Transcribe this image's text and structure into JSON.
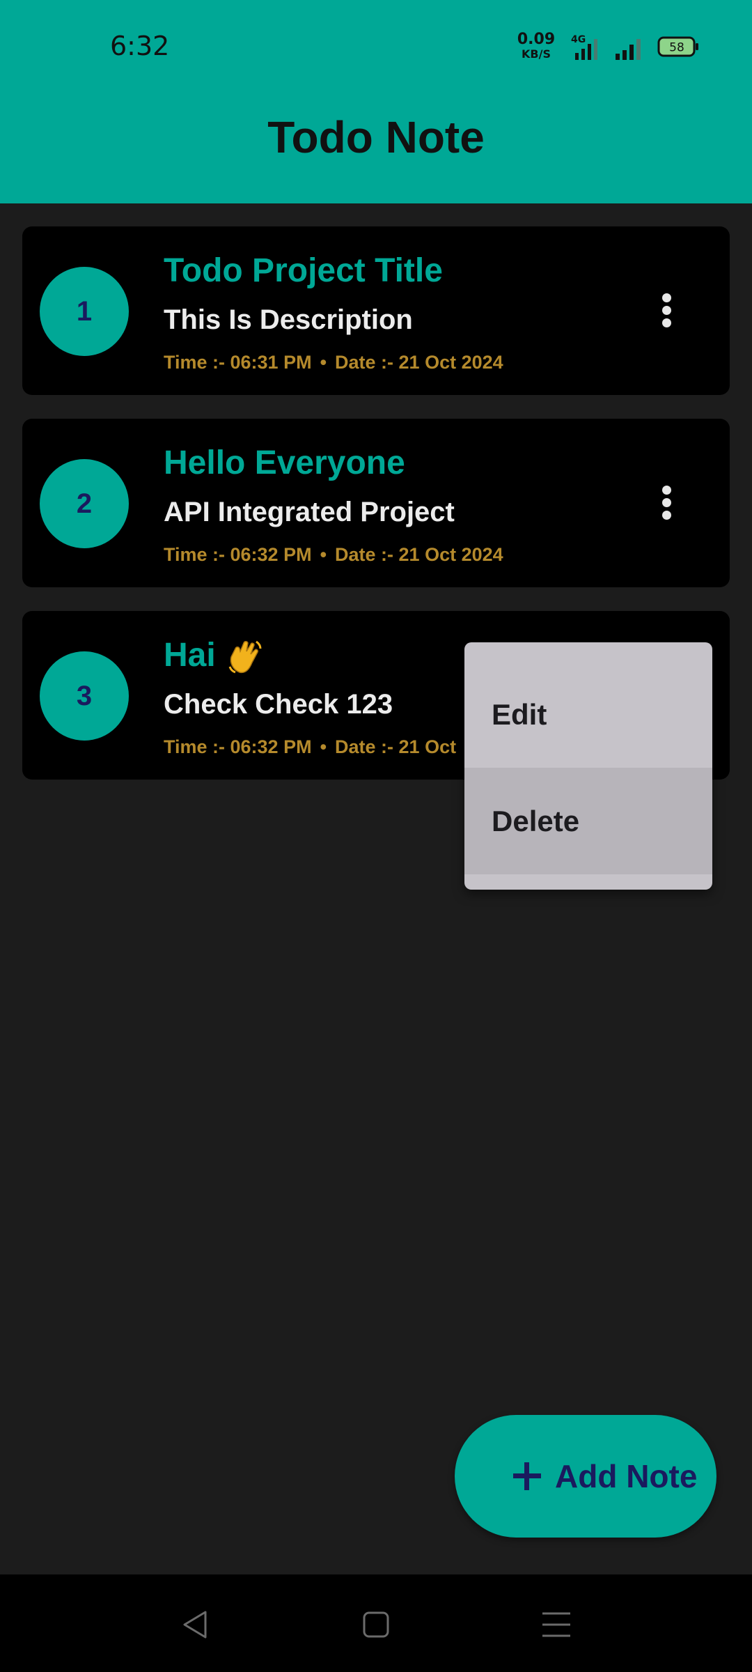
{
  "status_bar": {
    "time": "6:32",
    "net_speed_value": "0.09",
    "net_speed_unit": "KB/S",
    "network_type": "4G",
    "battery_level": "58",
    "icons": [
      "signal-4g-icon",
      "signal-icon",
      "battery-icon"
    ]
  },
  "header": {
    "title": "Todo Note"
  },
  "notes": [
    {
      "number": "1",
      "title": "Todo Project Title",
      "description": "This Is Description",
      "time": "Time :- 06:31 PM",
      "date": "Date :- 21 Oct 2024"
    },
    {
      "number": "2",
      "title": "Hello Everyone",
      "description": "API Integrated Project",
      "time": "Time :- 06:32 PM",
      "date": "Date :- 21 Oct 2024"
    },
    {
      "number": "3",
      "title": "Hai",
      "title_emoji": "waving-hand-icon",
      "description": "Check Check 123",
      "time": "Time :- 06:32 PM",
      "date": "Date :- 21 Oct"
    }
  ],
  "meta_separator": "•",
  "context_menu": {
    "items": [
      "Edit",
      "Delete"
    ],
    "highlighted": "Delete"
  },
  "fab": {
    "label": "Add Note",
    "icon": "plus-icon"
  },
  "nav_bar": {
    "icons": [
      "back-icon",
      "home-icon",
      "recents-icon"
    ]
  },
  "colors": {
    "accent": "#00a896",
    "background": "#1c1c1c",
    "card": "#000000",
    "meta_text": "#b58a2c",
    "number_text": "#1a1a5e",
    "menu_bg": "#c6c3c9"
  }
}
